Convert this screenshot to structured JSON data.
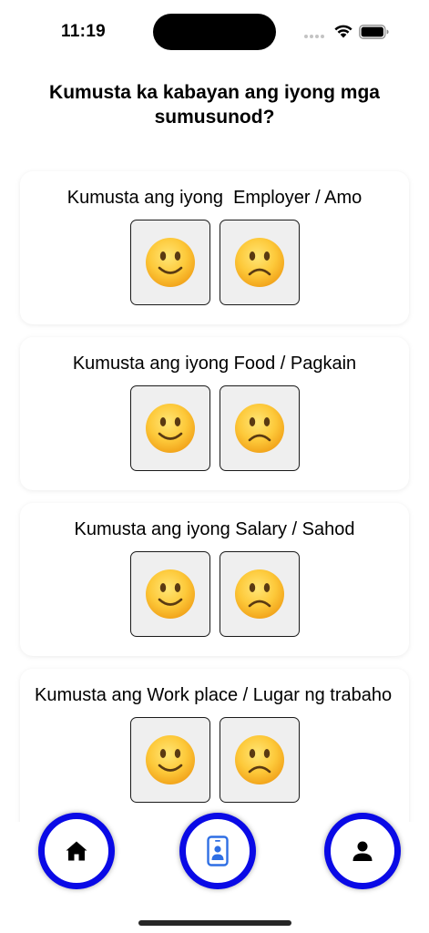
{
  "status_bar": {
    "time": "11:19"
  },
  "page": {
    "title": "Kumusta ka kabayan ang iyong mga sumusunod?"
  },
  "cards": [
    {
      "title": "Kumusta ang iyong  Employer / Amo"
    },
    {
      "title": "Kumusta ang iyong Food / Pagkain"
    },
    {
      "title": "Kumusta ang iyong Salary / Sahod"
    },
    {
      "title": "Kumusta ang Work place / Lugar ng trabaho"
    }
  ],
  "icons": {
    "happy": "slightly-smiling-face-icon",
    "sad": "slightly-frowning-face-icon",
    "home": "home-icon",
    "id_card": "id-card-icon",
    "profile": "person-icon"
  },
  "colors": {
    "nav_ring": "#0a0ae6",
    "id_icon": "#2f6fe4",
    "emoji_bg": "#efefef"
  }
}
